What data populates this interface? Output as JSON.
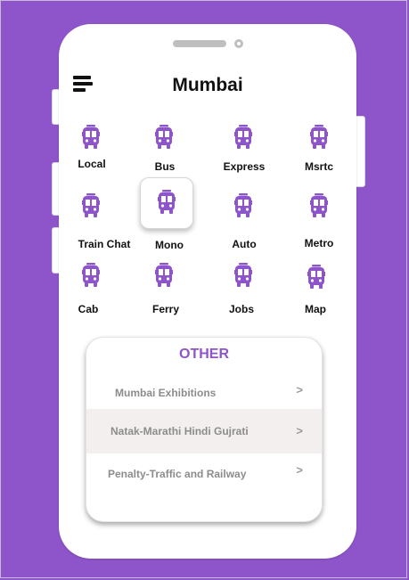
{
  "colors": {
    "background": "#8e54c9",
    "accent": "#8e54c9",
    "row_highlight": "#f3efee"
  },
  "header": {
    "title": "Mumbai",
    "menu_icon": "hamburger-menu-icon"
  },
  "transport": {
    "icon": "bus-icon",
    "selected": "Mono",
    "items": [
      {
        "label": "Local"
      },
      {
        "label": "Bus"
      },
      {
        "label": "Express"
      },
      {
        "label": "Msrtc"
      },
      {
        "label": "Train Chat"
      },
      {
        "label": "Mono"
      },
      {
        "label": "Auto"
      },
      {
        "label": "Metro"
      },
      {
        "label": "Cab"
      },
      {
        "label": "Ferry"
      },
      {
        "label": "Jobs"
      },
      {
        "label": "Map"
      }
    ]
  },
  "other": {
    "title": "OTHER",
    "chevron": ">",
    "items": [
      {
        "label": "Mumbai Exhibitions"
      },
      {
        "label": "Natak-Marathi Hindi Gujrati"
      },
      {
        "label": "Penalty-Traffic and Railway"
      }
    ]
  }
}
